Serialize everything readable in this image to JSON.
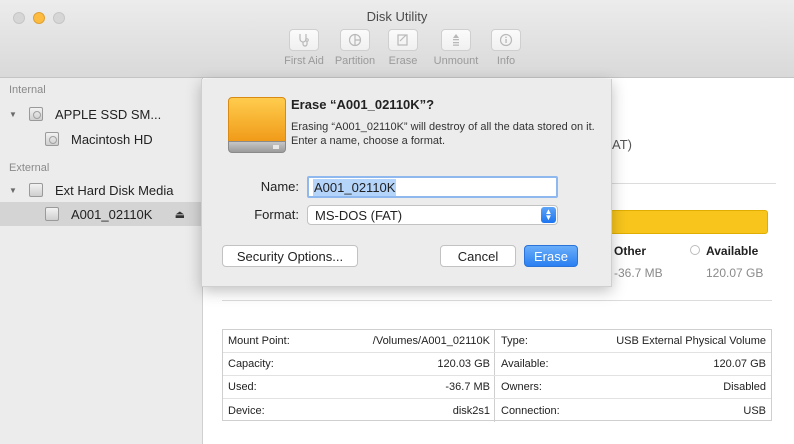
{
  "window": {
    "title": "Disk Utility"
  },
  "toolbar": {
    "items": [
      {
        "label": "First Aid",
        "icon": "stethoscope-icon"
      },
      {
        "label": "Partition",
        "icon": "pie-icon"
      },
      {
        "label": "Erase",
        "icon": "erase-icon"
      },
      {
        "label": "Unmount",
        "icon": "unmount-icon"
      },
      {
        "label": "Info",
        "icon": "info-icon"
      }
    ]
  },
  "sidebar": {
    "internal_label": "Internal",
    "external_label": "External",
    "items": [
      {
        "label": "APPLE SSD SM..."
      },
      {
        "label": "Macintosh HD"
      },
      {
        "label": "Ext Hard Disk Media"
      },
      {
        "label": "A001_02110K"
      }
    ],
    "eject_glyph": "⏏"
  },
  "main": {
    "format_fragment": "AT)",
    "legend": [
      {
        "name": "Other",
        "value": "-36.7 MB"
      },
      {
        "name": "Available",
        "value": "120.07 GB"
      }
    ],
    "usage_color": "#f7c51c",
    "info": {
      "rows": [
        {
          "k1": "Mount Point:",
          "v1": "/Volumes/A001_02110K",
          "k2": "Type:",
          "v2": "USB External Physical Volume"
        },
        {
          "k1": "Capacity:",
          "v1": "120.03 GB",
          "k2": "Available:",
          "v2": "120.07 GB"
        },
        {
          "k1": "Used:",
          "v1": "-36.7 MB",
          "k2": "Owners:",
          "v2": "Disabled"
        },
        {
          "k1": "Device:",
          "v1": "disk2s1",
          "k2": "Connection:",
          "v2": "USB"
        }
      ]
    }
  },
  "sheet": {
    "title": "Erase “A001_02110K”?",
    "description": "Erasing “A001_02110K” will destroy of all the data stored on it. Enter a name, choose a format.",
    "name_label": "Name:",
    "name_value": "A001_02110K",
    "format_label": "Format:",
    "format_value": "MS-DOS (FAT)",
    "security_button": "Security Options...",
    "cancel_button": "Cancel",
    "erase_button": "Erase",
    "accent": "#2a7ff1"
  }
}
